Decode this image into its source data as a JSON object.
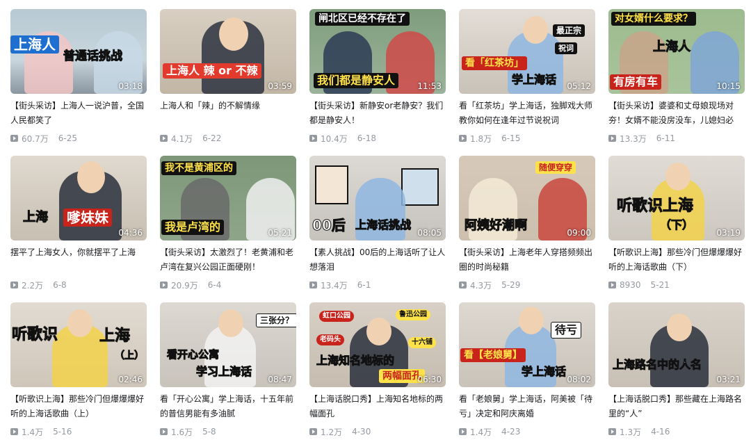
{
  "videos": [
    {
      "title": "【街头采访】上海人一说沪普，全国人民都笑了",
      "views": "60.7万",
      "date": "6-25",
      "duration": "03:18",
      "captions": [
        "上海人",
        "普通话挑战"
      ],
      "bg": "#c9d6dd"
    },
    {
      "title": "上海人和「辣」的不解情缘",
      "views": "4.1万",
      "date": "6-22",
      "duration": "03:59",
      "captions": [
        "上海人 辣 or 不辣"
      ],
      "bg": "#d7cfc4"
    },
    {
      "title": "【街头采访】新静安or老静安？我们都是静安人！",
      "views": "10.4万",
      "date": "6-18",
      "duration": "11:53",
      "captions": [
        "闸北区已经不存在了",
        "我们都是静安人"
      ],
      "bg": "#9bb39a"
    },
    {
      "title": "看「红茶坊」学上海话，独脚戏大师教你如何在逢年过节说祝词",
      "views": "1.8万",
      "date": "6-15",
      "duration": "05:12",
      "captions": [
        "最正宗",
        "祝词",
        "看「红茶坊」",
        "学上海话"
      ],
      "bg": "#d9d4cc"
    },
    {
      "title": "【街头采访】婆婆和丈母娘现场对夯！女婿不能没房没车，儿媳妇必",
      "views": "13.3万",
      "date": "6-11",
      "duration": "10:15",
      "captions": [
        "对女婿什么要求？",
        "上海人",
        "有房有车"
      ],
      "bg": "#a9c49c"
    },
    {
      "title": "摆平了上海女人，你就摆平了上海",
      "views": "2.2万",
      "date": "6-8",
      "duration": "04:36",
      "captions": [
        "上海",
        "嗲妹妹"
      ],
      "bg": "#d8d1c6"
    },
    {
      "title": "【街头采访】太激烈了！老黄浦和老卢湾在复兴公园正面硬刚！",
      "views": "20.9万",
      "date": "6-4",
      "duration": "05:21",
      "captions": [
        "我不是黄浦区的",
        "我是卢湾的"
      ],
      "bg": "#8fa58a"
    },
    {
      "title": "【素人挑战】00后的上海话听了让人想落泪",
      "views": "13.4万",
      "date": "6-1",
      "duration": "08:05",
      "captions": [
        "00后",
        "上海话挑战"
      ],
      "bg": "#d2cfcb"
    },
    {
      "title": "【街头采访】上海老年人穿搭频频出圈的时尚秘籍",
      "views": "4.3万",
      "date": "5-29",
      "duration": "09:00",
      "captions": [
        "随便穿穿",
        "阿姨好潮啊"
      ],
      "bg": "#cdbfae"
    },
    {
      "title": "【听歌识上海】那些冷门但爆爆爆好听的上海话歌曲（下）",
      "views": "8930",
      "date": "5-21",
      "duration": "03:19",
      "captions": [
        "听歌识上海",
        "（下）"
      ],
      "bg": "#d6d2cb"
    },
    {
      "title": "【听歌识上海】那些冷门但爆爆爆好听的上海话歌曲（上）",
      "views": "1.4万",
      "date": "5-16",
      "duration": "02:46",
      "captions": [
        "听歌识",
        "上海",
        "（上）"
      ],
      "bg": "#d9d3c9"
    },
    {
      "title": "看「开心公寓」学上海话，十五年前的普信男能有多油腻",
      "views": "1.6万",
      "date": "5-8",
      "duration": "08:47",
      "captions": [
        "三张分？",
        "看开心公寓",
        "学习上海话"
      ],
      "bg": "#d3cfc9"
    },
    {
      "title": "【上海话脱口秀】上海知名地标的两幅面孔",
      "views": "1.2万",
      "date": "4-30",
      "duration": "06:30",
      "captions": [
        "虹口公园",
        "鲁迅公园",
        "老码头",
        "十六铺",
        "上海知名地标的",
        "两幅面孔"
      ],
      "bg": "#cfc7be"
    },
    {
      "title": "看「老娘舅」学上海话，阿美被「待亏」决定和阿庆离婚",
      "views": "1.4万",
      "date": "4-23",
      "duration": "08:02",
      "captions": [
        "待亏",
        "看【老娘舅】",
        "学上海话"
      ],
      "bg": "#d4cec6"
    },
    {
      "title": "【上海话脱口秀】那些藏在上海路名里的“人”",
      "views": "1.3万",
      "date": "4-16",
      "duration": "03:21",
      "captions": [
        "上海路名中的人名"
      ],
      "bg": "#d3ccc3"
    }
  ]
}
